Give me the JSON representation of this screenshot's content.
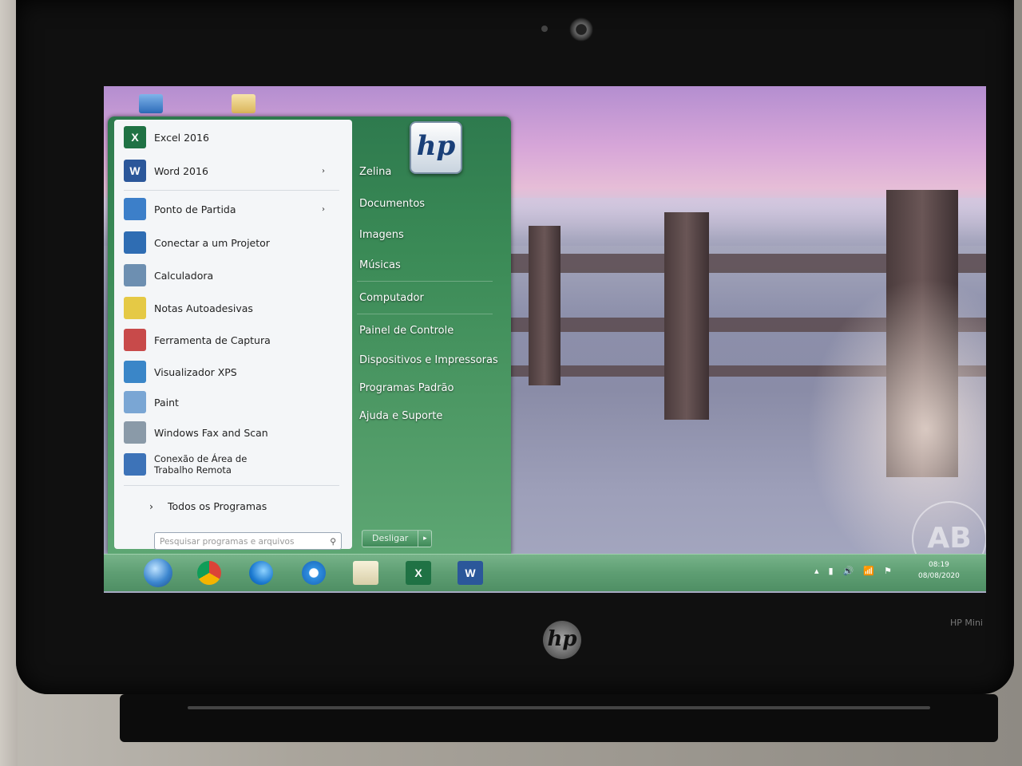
{
  "start_menu": {
    "pinned": [
      {
        "label": "Excel 2016",
        "icon": "excel-icon",
        "color": "#1f7244",
        "letter": "X"
      },
      {
        "label": "Word 2016",
        "icon": "word-icon",
        "color": "#2b579a",
        "letter": "W",
        "arrow": "›"
      }
    ],
    "recent": [
      {
        "label": "Ponto de Partida",
        "icon": "getting-started-icon",
        "color": "#3c7fc9",
        "arrow": "›"
      },
      {
        "label": "Conectar a um Projetor",
        "icon": "projector-icon",
        "color": "#2f6db3"
      },
      {
        "label": "Calculadora",
        "icon": "calculator-icon",
        "color": "#6d8fb1"
      },
      {
        "label": "Notas Autoadesivas",
        "icon": "sticky-notes-icon",
        "color": "#e5c945"
      },
      {
        "label": "Ferramenta de Captura",
        "icon": "snipping-tool-icon",
        "color": "#c84a4a"
      },
      {
        "label": "Visualizador XPS",
        "icon": "xps-viewer-icon",
        "color": "#3a86c8"
      },
      {
        "label": "Paint",
        "icon": "paint-icon",
        "color": "#7aa6d4"
      },
      {
        "label": "Windows Fax and Scan",
        "icon": "fax-scan-icon",
        "color": "#8a9aa8"
      },
      {
        "label": "Conexão de Área de Trabalho Remota",
        "icon": "remote-desktop-icon",
        "color": "#3d73b8"
      }
    ],
    "all_programs": "Todos os Programas",
    "all_programs_arrow": "›",
    "search_placeholder": "Pesquisar programas e arquivos",
    "search_icon": "⚲",
    "right": [
      "Zelina",
      "Documentos",
      "Imagens",
      "Músicas",
      "Computador",
      "Painel de Controle",
      "Dispositivos e Impressoras",
      "Programas Padrão",
      "Ajuda e Suporte"
    ],
    "shutdown_label": "Desligar",
    "shutdown_arrow": "▸",
    "user_badge": "hp"
  },
  "taskbar": {
    "items": [
      "start-orb-icon",
      "chrome-icon",
      "edge-icon",
      "internet-explorer-icon",
      "file-explorer-icon",
      "excel-icon",
      "word-icon"
    ],
    "excel_letter": "X",
    "word_letter": "W",
    "tray": [
      "▴",
      "▮",
      "🔊",
      "📶",
      "⚑"
    ],
    "clock_time": "08:19",
    "clock_date": "08/08/2020"
  },
  "device": {
    "logo": "hp",
    "model": "HP Mini"
  },
  "wallpaper": {
    "watermark": "AB"
  }
}
